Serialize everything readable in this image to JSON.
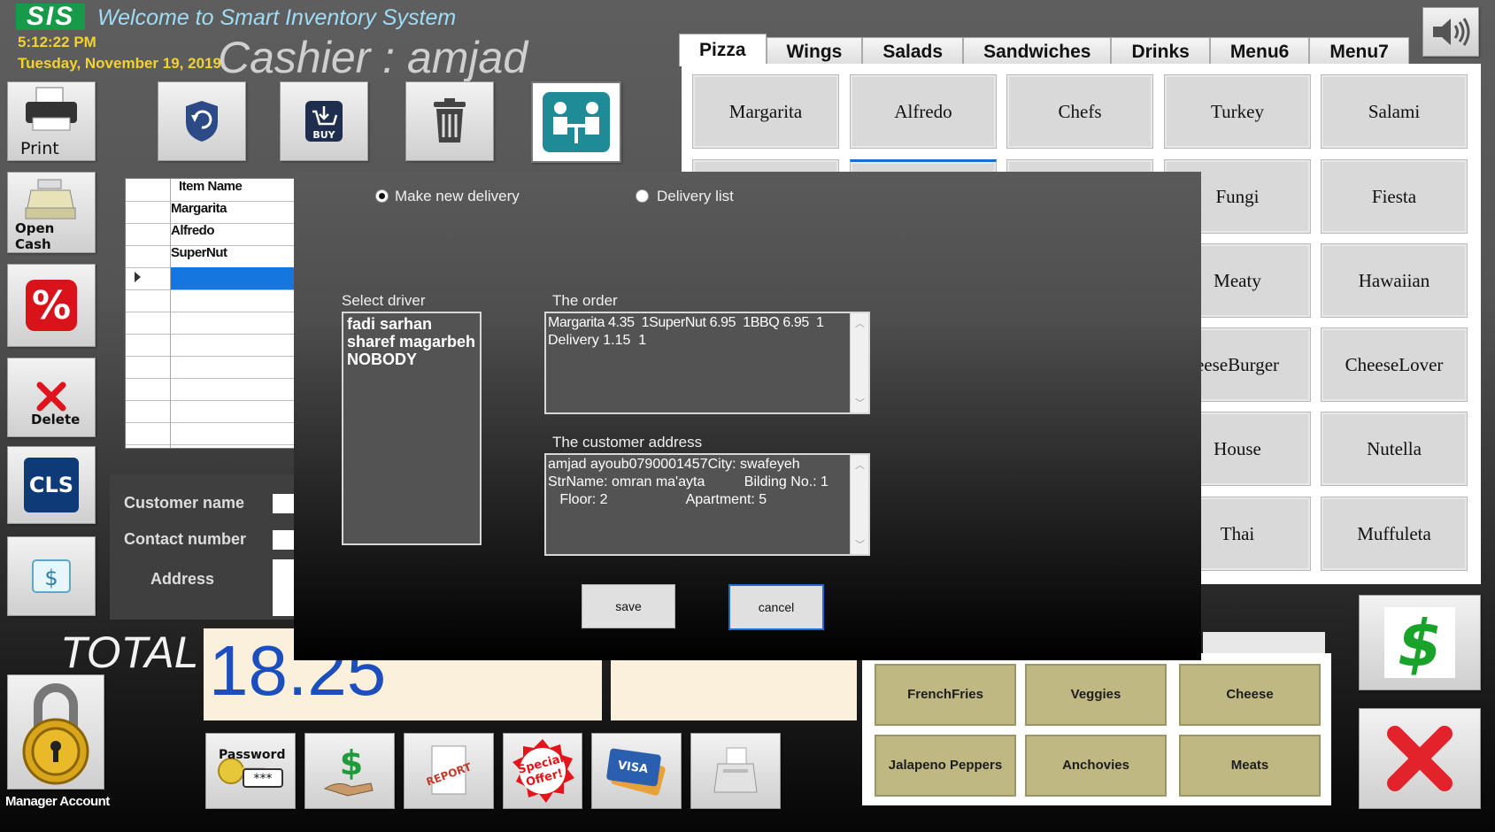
{
  "header": {
    "logo": "SIS",
    "welcome": "Welcome to Smart Inventory System",
    "time": "5:12:22 PM",
    "date": "Tuesday, November 19, 2019",
    "cashier": "Cashier : amjad"
  },
  "left_toolbar": {
    "print_label": "Print",
    "open_cash_label": "Open Cash",
    "delete_label": "Delete",
    "cls_label": "CLS",
    "buy_label": "BUY"
  },
  "order_grid": {
    "header": "Item Name",
    "rows": [
      "Margarita",
      "Alfredo",
      "SuperNut"
    ]
  },
  "customer": {
    "name_label": "Customer name",
    "contact_label": "Contact number",
    "address_label": "Address"
  },
  "totals": {
    "total_label": "TOTAL",
    "total_value": "18.25",
    "manager_label": "Manager Account",
    "password_label": "Password"
  },
  "menu": {
    "tabs": [
      "Pizza",
      "Wings",
      "Salads",
      "Sandwiches",
      "Drinks",
      "Menu6",
      "Menu7"
    ],
    "active_tab": "Pizza",
    "items_row1": [
      "Margarita",
      "Alfredo",
      "Chefs",
      "Turkey",
      "Salami"
    ],
    "items_col4": [
      "Fungi",
      "Meaty",
      "eeseBurger",
      "House",
      "Thai"
    ],
    "items_col5": [
      "Fiesta",
      "Hawaiian",
      "CheeseLover",
      "Nutella",
      "Muffuleta"
    ]
  },
  "extras": {
    "items": [
      "FrenchFries",
      "Veggies",
      "Cheese",
      "Jalapeno Peppers",
      "Anchovies",
      "Meats"
    ]
  },
  "dialog": {
    "radio_new": "Make new delivery",
    "radio_list": "Delivery list",
    "driver_label": "Select driver",
    "drivers": [
      "fadi sarhan",
      "sharef magarbeh",
      "NOBODY"
    ],
    "order_label": "The order",
    "order_line1": "Margarita 4.35  1SuperNut 6.95  1BBQ 6.95  1",
    "order_line2": "Delivery 1.15  1",
    "address_label": "The customer address",
    "address_line1": "amjad ayoub0790001457City: swafeyeh",
    "address_line2": "StrName: omran ma'ayta          Bilding No.: 1",
    "address_line3": "   Floor: 2                    Apartment: 5",
    "save_label": "save",
    "cancel_label": "cancel"
  },
  "colors": {
    "accent_blue": "#1576e0",
    "total_blue": "#1b4fbe",
    "clock_yellow": "#f2d22f",
    "extras_olive": "#bfb883"
  }
}
